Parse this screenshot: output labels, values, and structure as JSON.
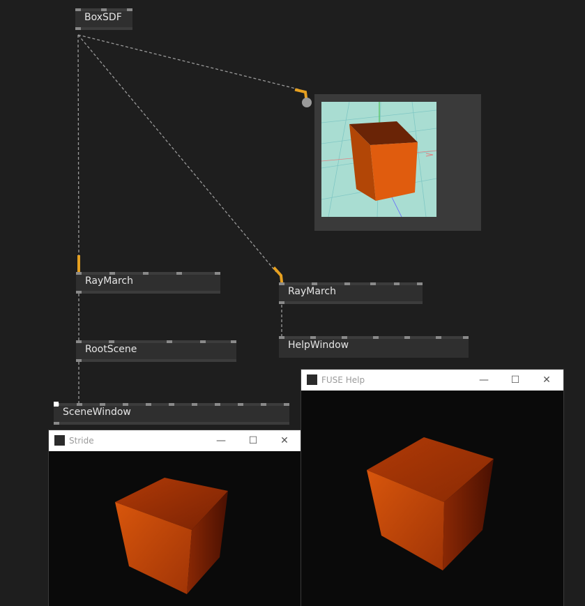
{
  "nodes": {
    "boxsdf": "BoxSDF",
    "raymarch_1": "RayMarch",
    "raymarch_2": "RayMarch",
    "rootscene": "RootScene",
    "helpwindow": "HelpWindow",
    "scenewindow": "SceneWindow"
  },
  "windows": {
    "stride": {
      "title": "Stride",
      "minimize": "—",
      "maximize": "☐",
      "close": "✕"
    },
    "fuse_help": {
      "title": "FUSE Help",
      "minimize": "—",
      "maximize": "☐",
      "close": "✕"
    }
  },
  "colors": {
    "canvas": "#1e1e1e",
    "node": "#2f2f2f",
    "pin": "#8a8a8a",
    "link_highlight": "#e6a020",
    "cube_front": "#d85a0c",
    "preview_bg": "#a9ddd2"
  },
  "icons": [
    "app-icon",
    "minimize-icon",
    "maximize-icon",
    "close-icon"
  ]
}
